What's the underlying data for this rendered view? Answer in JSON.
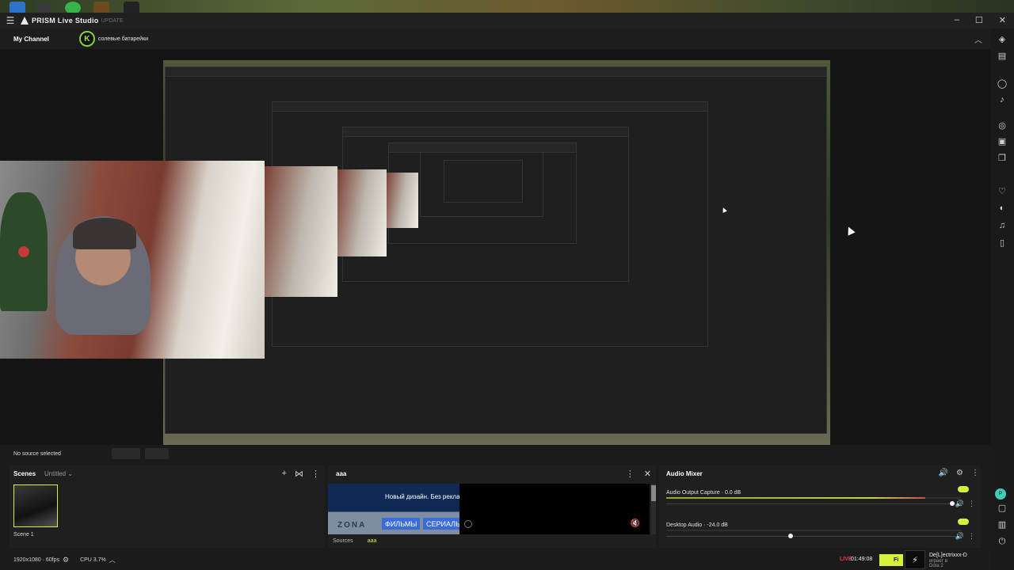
{
  "app": {
    "name": "PRISM Live Studio",
    "update_label": "UPDATE"
  },
  "channel": {
    "title": "My Channel",
    "avatar_letter": "K",
    "name": "солевые батарейки"
  },
  "selection": {
    "no_source_label": "No source selected"
  },
  "scenes": {
    "title": "Scenes",
    "collection": "Untitled",
    "items": [
      {
        "label": "Scene 1"
      }
    ]
  },
  "sources_dock": {
    "title": "aaa",
    "banner_promo": "Новый дизайн. Без реклам",
    "banner_logo": "ZONA",
    "banner_btn_1": "ФИЛЬМЫ",
    "banner_btn_2": "СЕРИАЛЫ",
    "tab_sources": "Sources",
    "tab_active": "aaa"
  },
  "mixer": {
    "title": "Audio Mixer",
    "tracks": [
      {
        "name": "Audio Output Capture",
        "db": "0.0 dB",
        "level": 0.88,
        "fader": 0.985
      },
      {
        "name": "Desktop Audio",
        "db": "-24.0 dB",
        "level": 0.0,
        "fader": 0.43
      }
    ]
  },
  "status": {
    "resolution": "1920x1080 · 60fps",
    "cpu": "CPU 3.7%",
    "live_label": "LIVE",
    "timer": "01:49:08",
    "finish_label": "Fi",
    "game_user": "De[L]ectrixxx-D",
    "game_state_1": "играет в",
    "game_state_2": "Dota 2"
  },
  "colors": {
    "accent": "#d6f03c",
    "live": "#e04040",
    "panel": "#1f1f1f"
  },
  "sidebar_icons": [
    "prism-chat-icon",
    "layout-icon",
    "comment-icon",
    "bell-icon",
    "camera-icon",
    "record-icon",
    "copy-icon",
    "heart-icon",
    "sticker-icon",
    "music-icon",
    "trash-icon",
    "prism-badge-icon",
    "chat-bubble-icon",
    "grid-icon",
    "power-icon"
  ]
}
